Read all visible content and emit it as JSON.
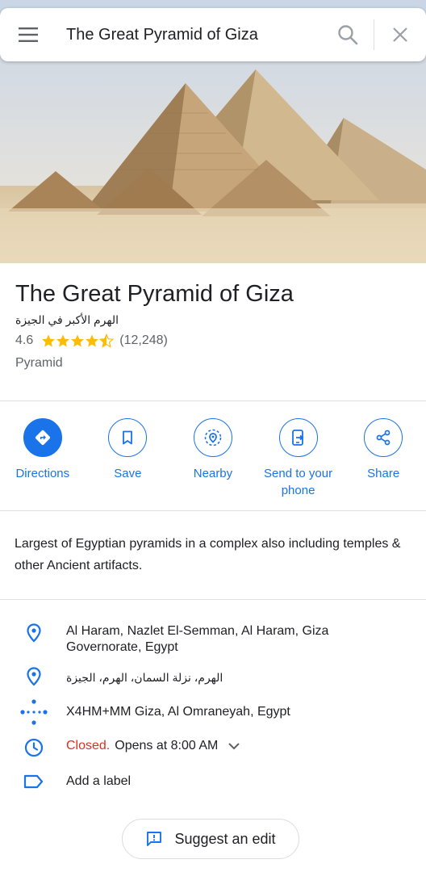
{
  "search": {
    "query": "The Great Pyramid of Giza"
  },
  "place": {
    "title": "The Great Pyramid of Giza",
    "native_name": "الهرم الأكبر في الجيزة",
    "rating": "4.6",
    "rating_value": 4.6,
    "stars_max": 5,
    "review_count": "(12,248)",
    "category": "Pyramid"
  },
  "actions": [
    {
      "label": "Directions",
      "icon": "directions-icon"
    },
    {
      "label": "Save",
      "icon": "bookmark-icon"
    },
    {
      "label": "Nearby",
      "icon": "nearby-icon"
    },
    {
      "label": "Send to your phone",
      "icon": "send-to-phone-icon"
    },
    {
      "label": "Share",
      "icon": "share-icon"
    }
  ],
  "description": "Largest of Egyptian pyramids in a complex also including temples & other Ancient artifacts.",
  "info": {
    "address": "Al Haram, Nazlet El-Semman, Al Haram, Giza Governorate, Egypt",
    "address_native": "الهرم، نزلة السمان، الهرم، الجيزة",
    "plus_code": "X4HM+MM Giza, Al Omraneyah, Egypt",
    "hours_status": "Closed.",
    "hours_detail": "Opens at 8:00 AM",
    "label_action": "Add a label"
  },
  "suggest_edit": "Suggest an edit",
  "colors": {
    "accent": "#1a73e8",
    "closed": "#d93025",
    "star": "#fbbc04"
  }
}
